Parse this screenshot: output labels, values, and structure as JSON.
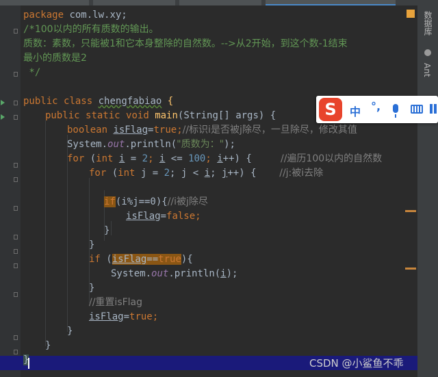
{
  "code": {
    "line1": {
      "kw": "package",
      "rest": " com.lw.xy;"
    },
    "line2": {
      "open": "/*",
      "text": "100以内的所有质数的输出。"
    },
    "line3": "质数：素数，只能被1和它本身整除的自然数。-->从2开始，到这个数-1结束",
    "line4": "最小的质数是2",
    "line5": " */",
    "line7": {
      "kw1": "public",
      "kw2": "class",
      "name": "chengfabiao",
      "brace": "{"
    },
    "line8": {
      "kw1": "public",
      "kw2": "static",
      "kw3": "void",
      "method": "main",
      "params": "(String[] args) {"
    },
    "line9": {
      "kw": "boolean",
      "var": "isFlag",
      "eq": "=",
      "val": "true",
      "semi": ";",
      "comment": "//标识i是否被j除尽，一旦除尽，修改其值"
    },
    "line10": {
      "pre": "System.",
      "field": "out",
      "mid": ".println(",
      "str": "\"质数为：\"",
      "post": ");"
    },
    "line11": {
      "kw": "for",
      "p1": " (",
      "kw2": "int",
      "sp": " ",
      "i1": "i",
      "eq": " = ",
      "n1": "2",
      "semi": "; ",
      "i2": "i",
      "lt": " <= ",
      "n2": "100",
      "semi2": "; ",
      "i3": "i",
      "inc": "++) {",
      "comment": "//遍历100以内的自然数"
    },
    "line12": {
      "kw": "for",
      "p1": " (",
      "kw2": "int",
      "rest1": " j = ",
      "n1": "2",
      "rest2": "; j < ",
      "i1": "i",
      "rest3": "; ",
      "j2": "j",
      "inc": "++) {",
      "comment": "//j:被i去除"
    },
    "line14": {
      "kw": "if",
      "body": "(i%j==0){",
      "comment": "//i被j除尽"
    },
    "line15": {
      "var": "isFlag",
      "eq": "=",
      "val": "false",
      "semi": ";"
    },
    "line16": "}",
    "line17": "}",
    "line18": {
      "kw": "if",
      "p1": " (",
      "var": "isFlag",
      "eq": "==",
      "val": "true",
      "p2": "){"
    },
    "line19": {
      "pre": "System.",
      "field": "out",
      "mid": ".println(",
      "i": "i",
      "post": ");"
    },
    "line20": "}",
    "line21": {
      "comment": "//重置isFlag"
    },
    "line22": {
      "var": "isFlag",
      "eq": "=",
      "val": "true",
      "semi": ";"
    },
    "line23": "}",
    "line24": "}",
    "line25": "}"
  },
  "right_sidebar": {
    "database": "数据库",
    "ant": "Ant"
  },
  "ime": {
    "logo": "S",
    "lang": "中",
    "punct": "°,"
  },
  "watermark": "CSDN @小鲨鱼不乖",
  "colors": {
    "keyword": "#cc7832",
    "comment": "#808080",
    "number": "#6897bb",
    "string": "#6a8759",
    "function": "#ffc66d",
    "field": "#9876aa",
    "ime_accent": "#2a6fd6"
  }
}
